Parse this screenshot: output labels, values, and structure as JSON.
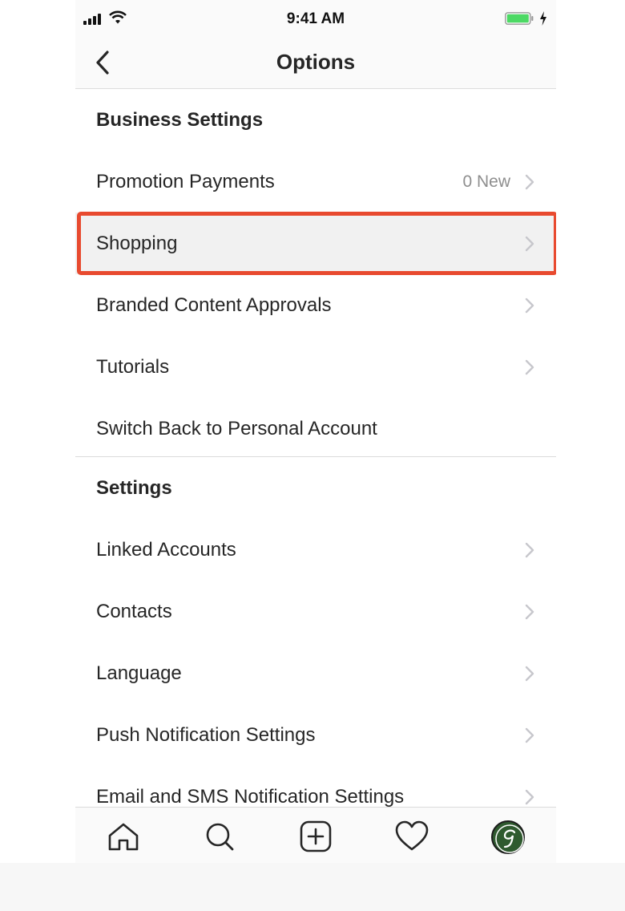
{
  "status_bar": {
    "time": "9:41 AM",
    "signal_icon": "cellular-signal-icon",
    "wifi_icon": "wifi-icon",
    "battery_icon": "battery-charging-icon",
    "battery_color": "#4cd964"
  },
  "nav": {
    "title": "Options",
    "back_icon": "back-chevron-icon"
  },
  "business_settings": {
    "header": "Business Settings",
    "items": [
      {
        "label": "Promotion Payments",
        "detail": "0 New"
      },
      {
        "label": "Shopping"
      },
      {
        "label": "Branded Content Approvals"
      },
      {
        "label": "Tutorials"
      },
      {
        "label": "Switch Back to Personal Account"
      }
    ]
  },
  "settings": {
    "header": "Settings",
    "items": [
      {
        "label": "Linked Accounts"
      },
      {
        "label": "Contacts"
      },
      {
        "label": "Language"
      },
      {
        "label": "Push Notification Settings"
      },
      {
        "label": "Email and SMS Notification Settings"
      }
    ]
  },
  "highlight_color": "#e84a2f",
  "tab_bar": {
    "tabs": [
      "home-icon",
      "search-icon",
      "add-post-icon",
      "heart-icon",
      "profile-avatar"
    ]
  }
}
